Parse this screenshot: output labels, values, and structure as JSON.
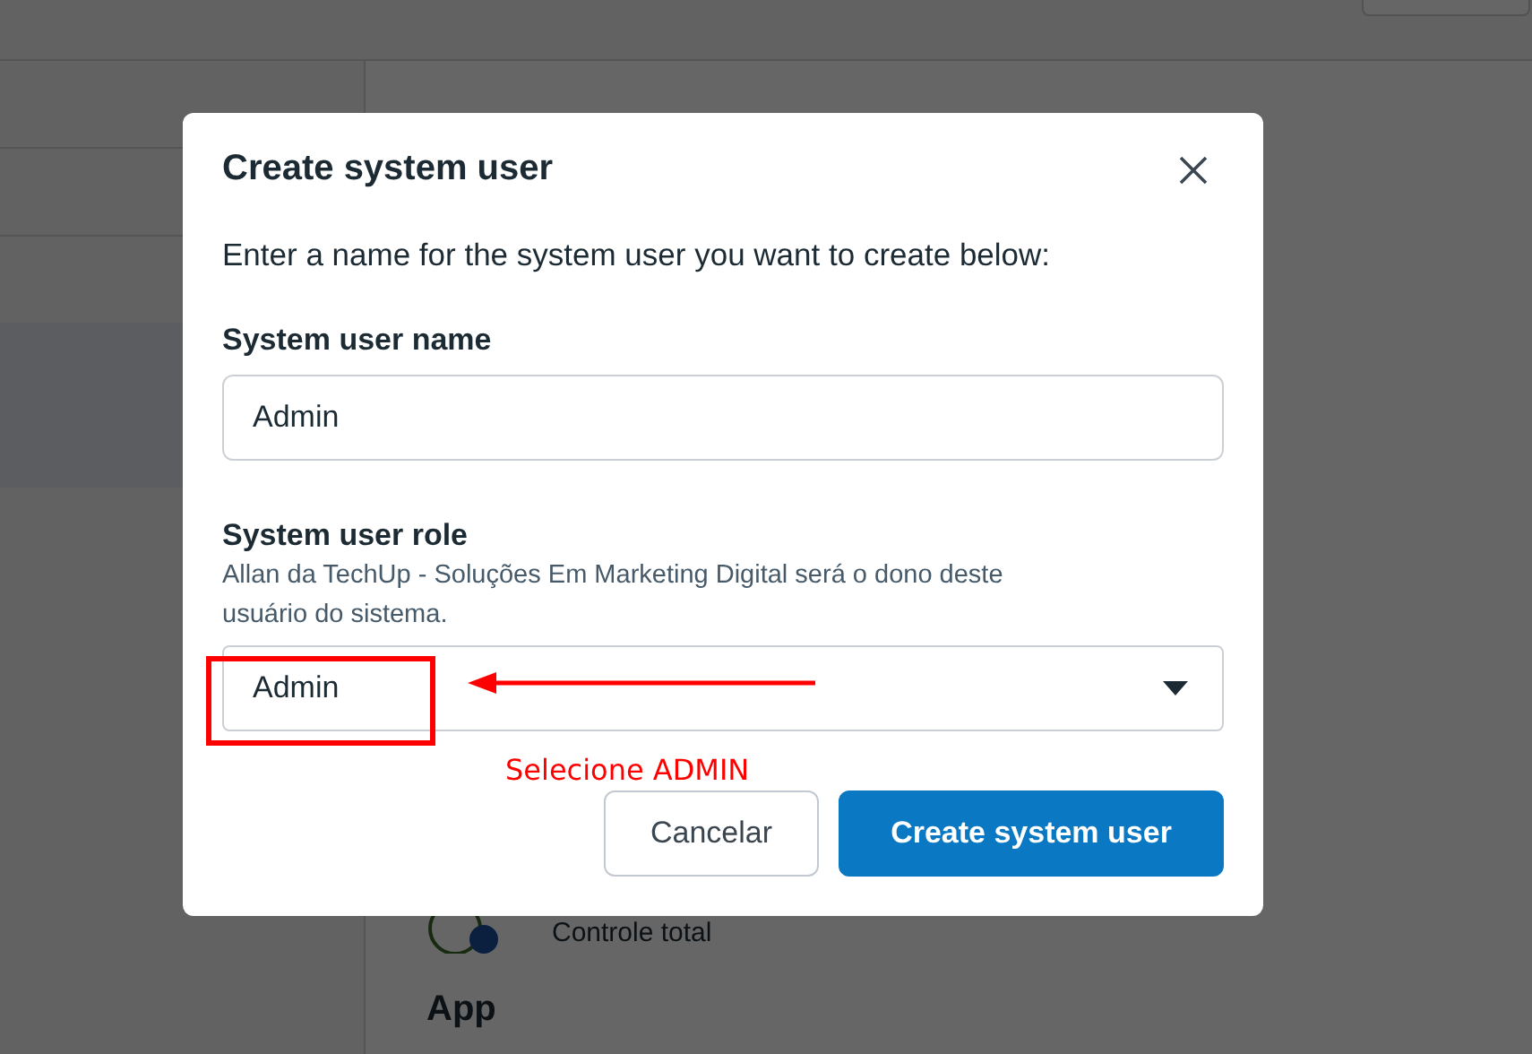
{
  "background": {
    "items": [
      {
        "label": "Controle total"
      }
    ],
    "section_title": "App"
  },
  "dialog": {
    "title": "Create system user",
    "instructions": "Enter a name for the system user you want to create below:",
    "fields": [
      {
        "kind": "text",
        "label": "System user name",
        "value": "Admin"
      },
      {
        "kind": "select",
        "label": "System user role",
        "help": "Allan da TechUp - Soluções Em Marketing Digital será o dono deste usuário do sistema.",
        "value": "Admin"
      }
    ],
    "buttons": [
      {
        "kind": "secondary",
        "label": "Cancelar"
      },
      {
        "kind": "primary",
        "label": "Create system user"
      }
    ]
  },
  "annotation": {
    "label": "Selecione ADMIN"
  }
}
